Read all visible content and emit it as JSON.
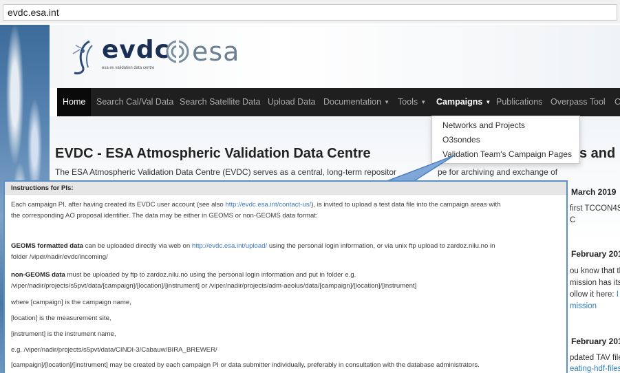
{
  "browser": {
    "url": "evdc.esa.int"
  },
  "logo": {
    "name": "evdc",
    "subtitle": "esa ev validation data centre",
    "partner": "esa"
  },
  "nav": {
    "items": [
      {
        "label": "Home",
        "caret": false
      },
      {
        "label": "Search Cal/Val Data",
        "caret": false
      },
      {
        "label": "Search Satellite Data",
        "caret": false
      },
      {
        "label": "Upload Data",
        "caret": false
      },
      {
        "label": "Documentation",
        "caret": true
      },
      {
        "label": "Tools",
        "caret": true
      },
      {
        "label": "Campaigns",
        "caret": true
      },
      {
        "label": "Publications",
        "caret": false
      },
      {
        "label": "Overpass Tool",
        "caret": false
      },
      {
        "label": "C",
        "caret": false
      }
    ]
  },
  "dropdown": {
    "items": [
      "Networks and Projects",
      "O3sondes",
      "Validation Team's Campaign Pages"
    ]
  },
  "page": {
    "title": "EVDC - ESA Atmospheric Validation Data Centre",
    "title_tail": "s and",
    "intro_left": "The ESA Atmospheric Validation Data Centre (EVDC) serves as a central, long-term repositor",
    "intro_right": "pe for archiving and exchange of"
  },
  "side": {
    "date1": "March 2019",
    "line1a": "first TCCON4S",
    "line1b": "C",
    "date2": "February 201",
    "line2a": "ou know that th",
    "line2b": "mission has its",
    "line2c_text": "ollow it here: ",
    "line2c_link": "I",
    "line2d": "mission",
    "date3": "February 201",
    "line3a": "pdated TAV file",
    "line3b": "eating-hdf-files"
  },
  "panel": {
    "heading": "Instructions for PIs:",
    "p1a": "Each campaign PI, after having created its EVDC user account (see also ",
    "p1_link": "http://evdc.esa.int/contact-us/",
    "p1b": "), is invited to upload a test data file into the campaign areas with",
    "p1c": "the corresponding AO proposal identifier. The data may be either in GEOMS or non-GEOMS data format:",
    "p2_bold": "GEOMS formatted data",
    "p2a": " can be uploaded directly via web on ",
    "p2_link": "http://evdc.esa.int/upload/",
    "p2b": " using the personal login information, or via unix ftp upload to zardoz.nilu.no in",
    "p2c": "folder /viper/nadir/evdc/incoming/",
    "p3_bold": "non-GEOMS data",
    "p3a": " must be uploaded by ftp to zardoz.nilu.no using the personal login information and put in folder e.g.",
    "p3b": "/viper/nadir/projects/s5pvt/data/[campaign]/[location]/[instrument]  or /viper/nadir/projects/adm-aeolus/data/[campaign]/[location]/[instrument]",
    "p4": "where [campaign] is the campaign name,",
    "p5": "[location] is the measurement site,",
    "p6": "[instrument] is the instrument name,",
    "p7": " e.g. /viper/nadir/projects/s5pvt/data/CINDI-3/Cabauw/BIRA_BREWER/",
    "p8": "[campaign]/[location]/[instrument]  may be created by each campaign PI or data submitter individually, preferably in consultation with the database administrators."
  }
}
